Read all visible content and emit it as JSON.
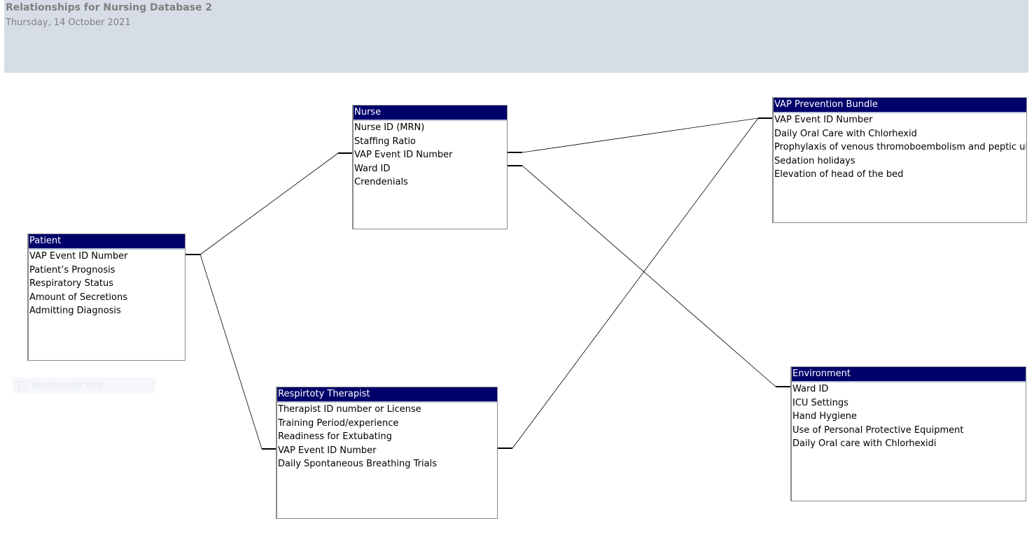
{
  "report": {
    "title": "Relationships for Nursing Database 2",
    "date": "Thursday, 14 October 2021"
  },
  "snip_label": "Rectangular Snip",
  "tables": {
    "nurse": {
      "title": "Nurse",
      "fields": [
        "Nurse ID (MRN)",
        "Staffing Ratio",
        "VAP Event ID Number",
        "Ward ID",
        "Crendenials"
      ]
    },
    "vap": {
      "title": "VAP Prevention Bundle",
      "fields": [
        "VAP Event ID Number",
        "Daily Oral Care with Chlorhexid",
        "Prophylaxis of venous thromoboembolism and peptic ul",
        "Sedation holidays",
        "Elevation of head of the bed"
      ]
    },
    "patient": {
      "title": "Patient",
      "fields": [
        "VAP Event ID Number",
        "Patient’s Prognosis",
        "Respiratory Status",
        "Amount of Secretions",
        "Admitting Diagnosis"
      ]
    },
    "therapist": {
      "title": "Respirtoty Therapist",
      "fields": [
        "Therapist ID number or License",
        "Training Period/experience",
        "Readiness for Extubating",
        "VAP Event ID Number",
        "Daily Spontaneous Breathing Trials"
      ]
    },
    "environment": {
      "title": "Environment",
      "fields": [
        "Ward ID",
        "ICU Settings",
        "Hand Hygiene",
        "Use of Personal Protective Equipment",
        "Daily Oral care with Chlorhexidi"
      ]
    }
  },
  "relationships": [
    {
      "from": "Patient.VAP Event ID Number",
      "to": "Nurse.VAP Event ID Number"
    },
    {
      "from": "Patient.VAP Event ID Number",
      "to": "Respirtoty Therapist.VAP Event ID Number"
    },
    {
      "from": "Nurse.VAP Event ID Number",
      "to": "VAP Prevention Bundle.VAP Event ID Number"
    },
    {
      "from": "Nurse.Ward ID",
      "to": "Environment.Ward ID"
    },
    {
      "from": "Respirtoty Therapist.VAP Event ID Number",
      "to": "VAP Prevention Bundle.VAP Event ID Number"
    }
  ]
}
